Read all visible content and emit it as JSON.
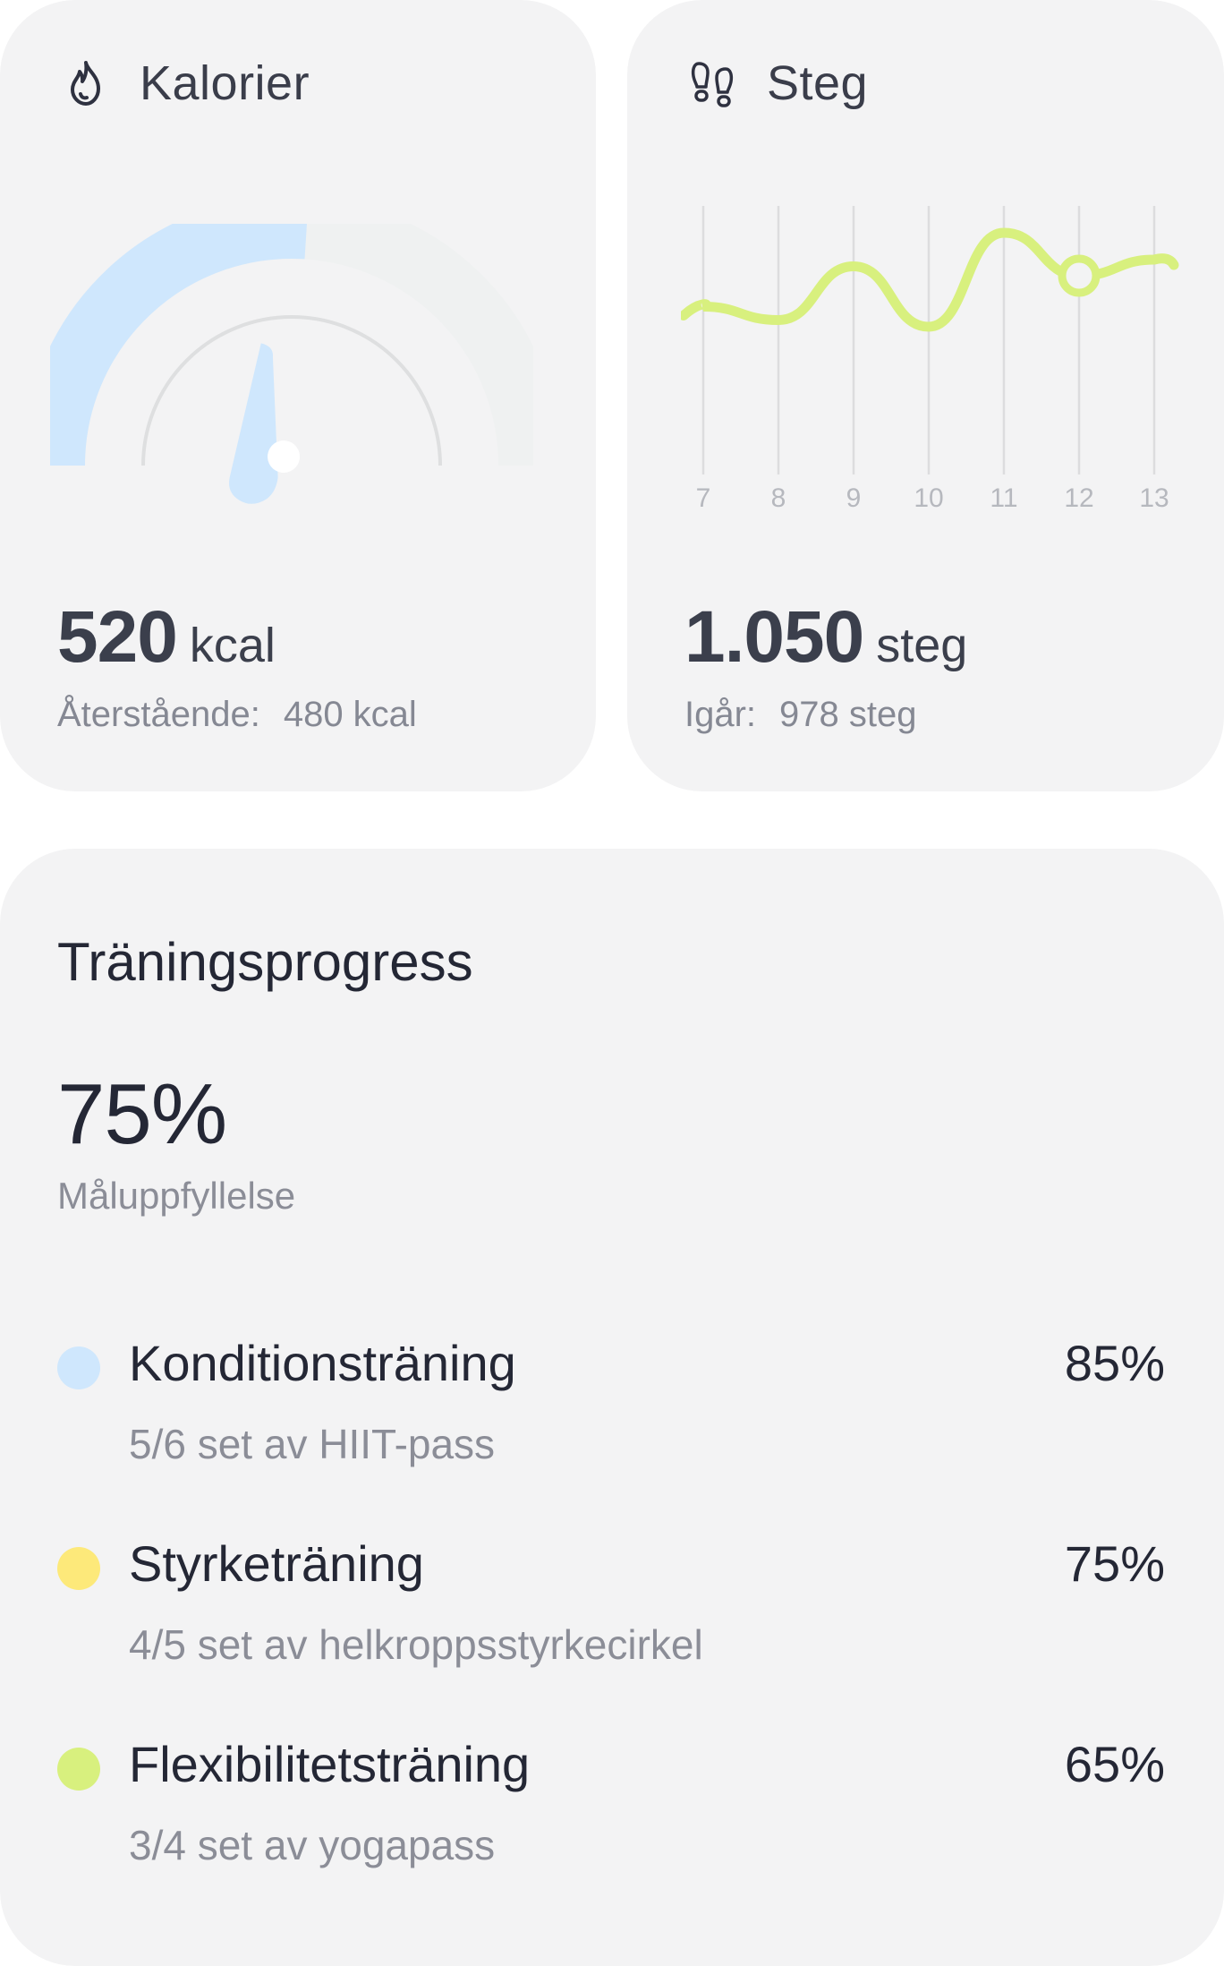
{
  "calories": {
    "title": "Kalorier",
    "icon": "flame-icon",
    "value": "520",
    "unit": "kcal",
    "remaining_label": "Återstående:",
    "remaining_value": "480 kcal",
    "gauge_fill_fraction": 0.52,
    "gauge_color": "#cfe7fd",
    "gauge_track_color": "#eff1f1"
  },
  "steps": {
    "title": "Steg",
    "icon": "footprints-icon",
    "value": "1.050",
    "unit": "steg",
    "yesterday_label": "Igår:",
    "yesterday_value": "978 steg",
    "line_color": "#d8f07e"
  },
  "chart_data": {
    "type": "line",
    "categories": [
      "7",
      "8",
      "9",
      "10",
      "11",
      "12",
      "13"
    ],
    "series": [
      {
        "values": [
          0.45,
          0.35,
          0.75,
          0.3,
          1.0,
          0.68,
          0.8
        ]
      }
    ],
    "highlight_category": "12",
    "grid": true
  },
  "progress": {
    "title": "Träningsprogress",
    "percent": "75%",
    "subtitle": "Måluppfyllelse",
    "items": [
      {
        "name": "Konditionsträning",
        "percent": "85%",
        "detail": "5/6 set av HIIT-pass",
        "color": "#cfe7fd"
      },
      {
        "name": "Styrketräning",
        "percent": "75%",
        "detail": "4/5 set av helkroppsstyrkecirkel",
        "color": "#fde97a"
      },
      {
        "name": "Flexibilitetsträning",
        "percent": "65%",
        "detail": "3/4 set av yogapass",
        "color": "#d8f07e"
      }
    ]
  }
}
